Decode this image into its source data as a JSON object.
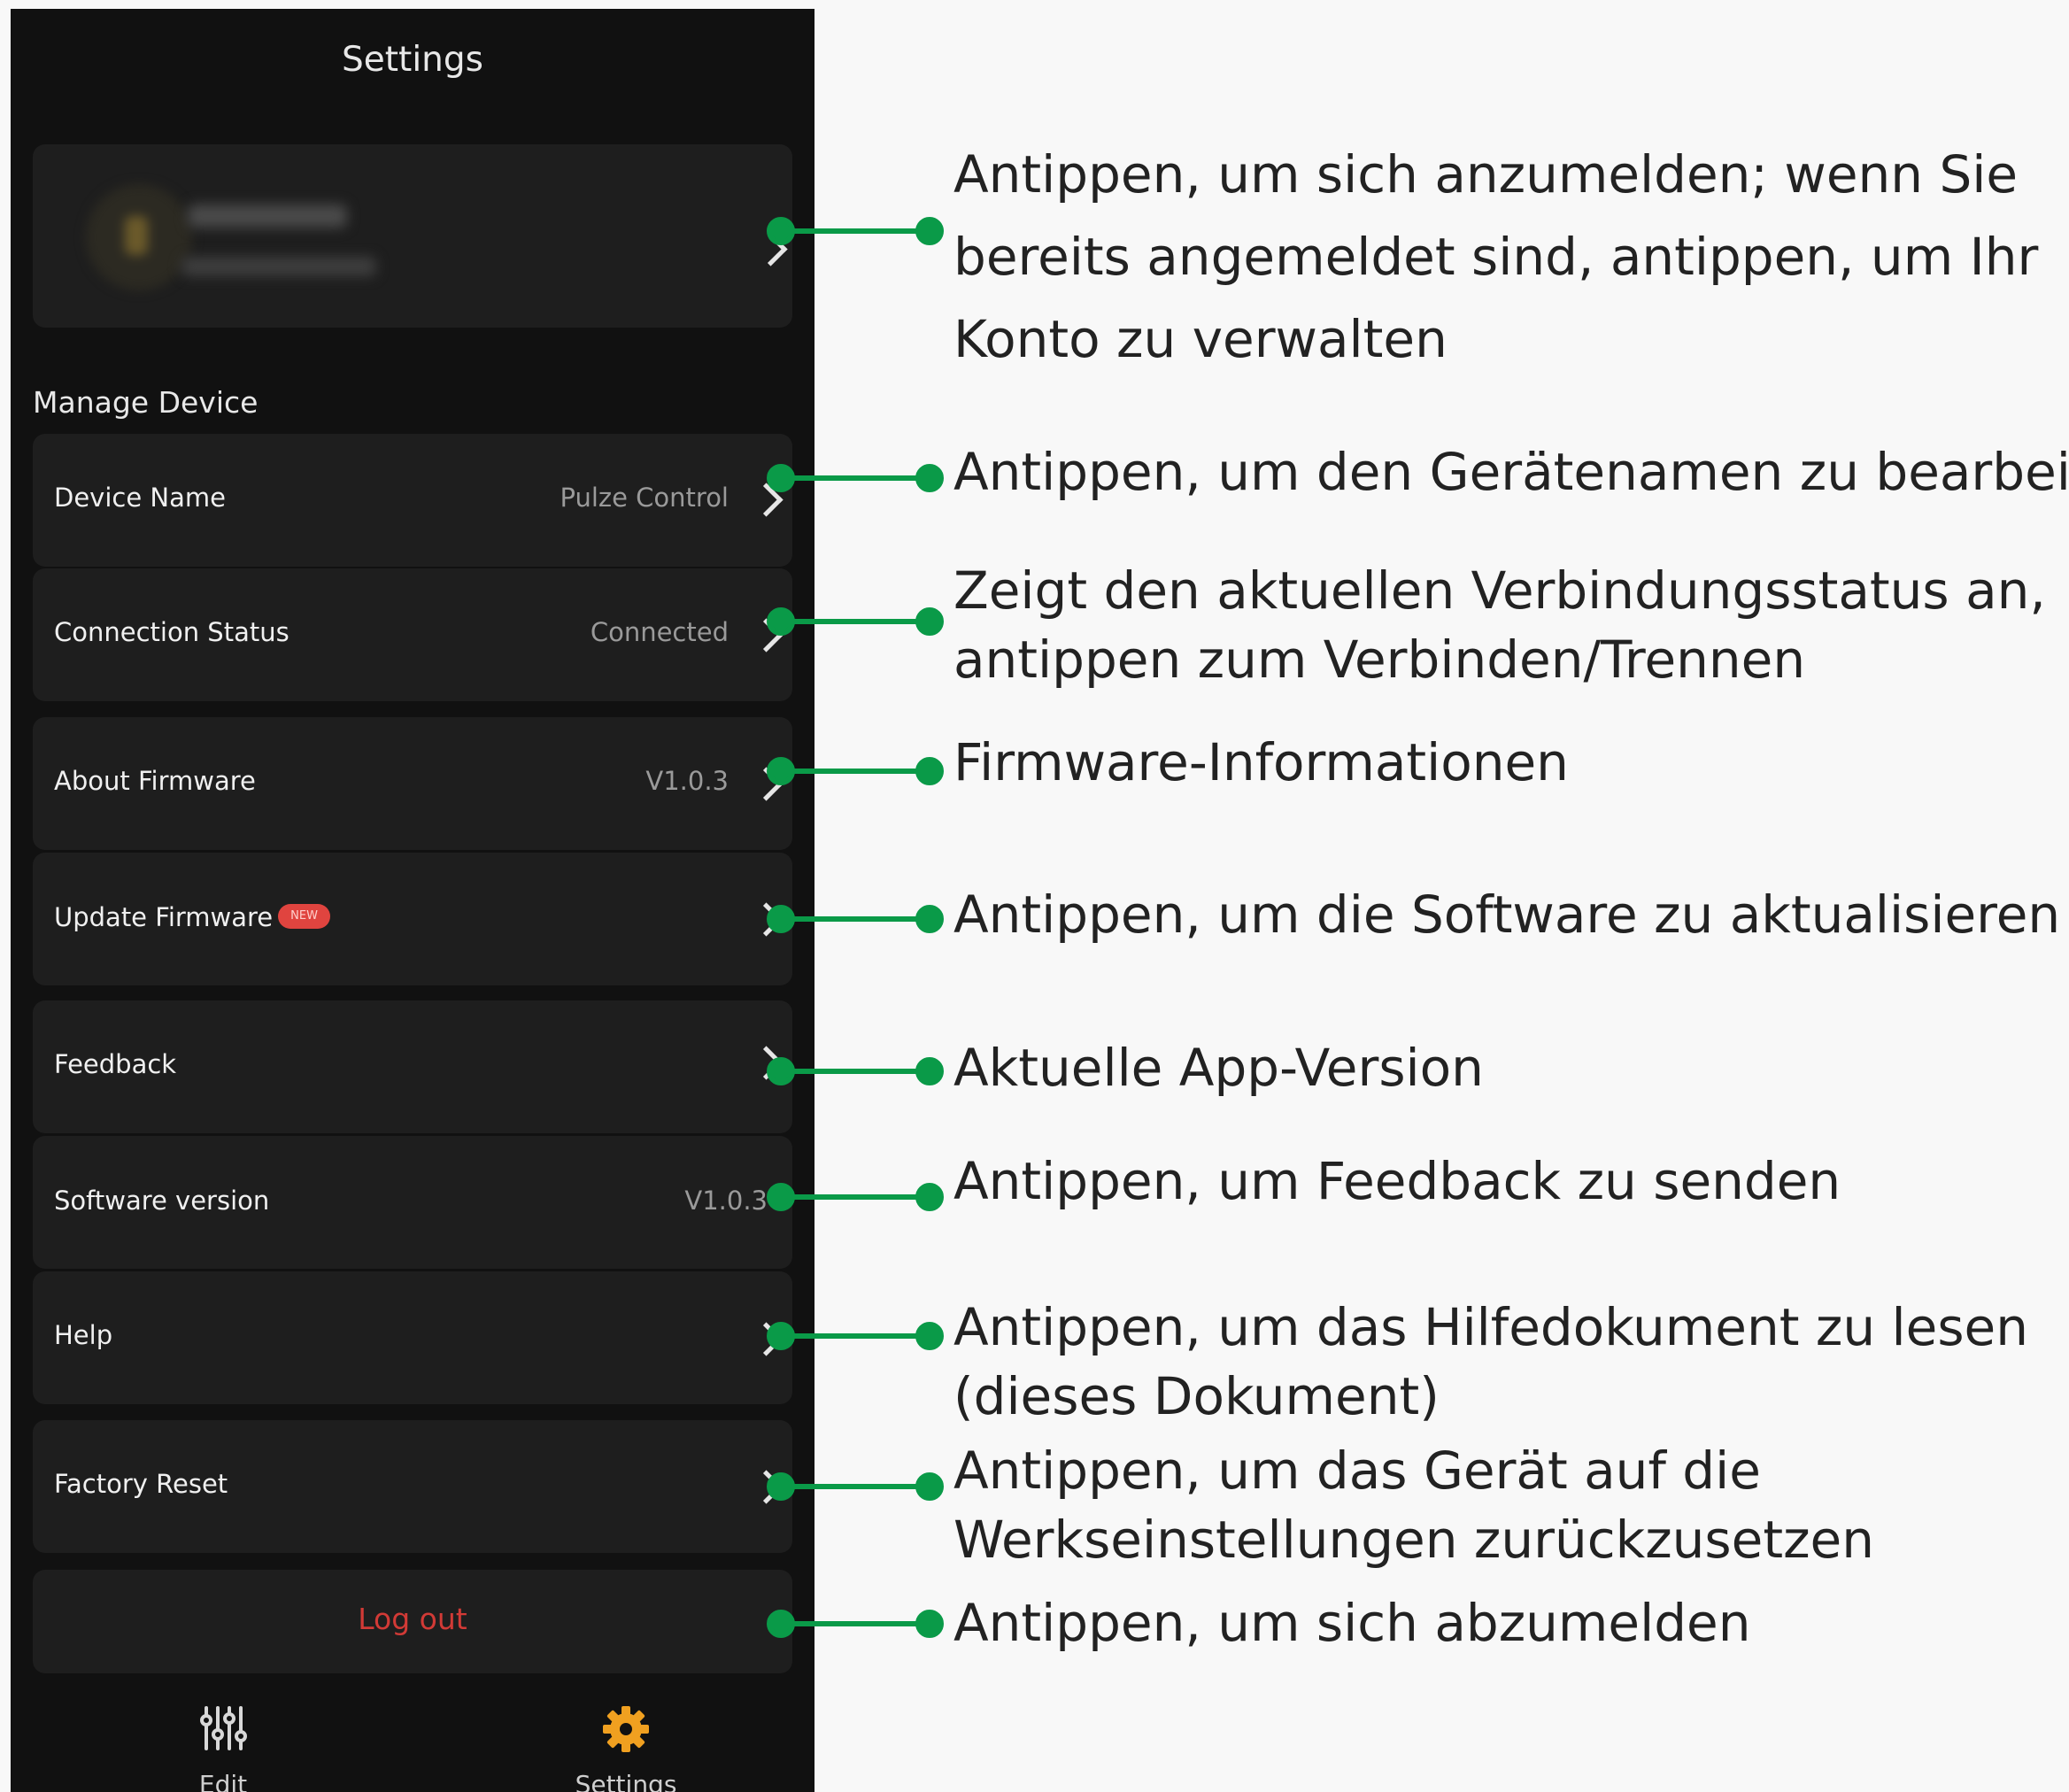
{
  "screen": {
    "title": "Settings"
  },
  "profile": {
    "name_blurred": "Shawn Wang",
    "email_blurred": "a1b2c3@mail.com"
  },
  "section_manage_device": "Manage Device",
  "rows": [
    {
      "label": "Device Name",
      "value": "Pulze Control",
      "chevron": true
    },
    {
      "label": "Connection Status",
      "value": "Connected",
      "chevron": true
    },
    {
      "label": "About Firmware",
      "value": "V1.0.3",
      "chevron": true
    },
    {
      "label": "Update Firmware",
      "badge": "NEW",
      "value": "",
      "chevron": true
    },
    {
      "label": "Feedback",
      "value": "",
      "chevron": true
    },
    {
      "label": "Software version",
      "value": "V1.0.3",
      "chevron": false
    },
    {
      "label": "Help",
      "value": "",
      "chevron": true
    },
    {
      "label": "Factory Reset",
      "value": "",
      "chevron": true
    }
  ],
  "logout_label": "Log out",
  "tabbar": {
    "edit": {
      "label": "Edit",
      "icon": "sliders-icon"
    },
    "settings": {
      "label": "Settings",
      "icon": "gear-icon"
    }
  },
  "callouts": [
    {
      "lines": [
        "Antippen, um sich anzumelden; wenn Sie",
        "bereits angemeldet sind, antippen, um Ihr",
        "Konto zu verwalten"
      ]
    },
    {
      "lines": [
        "Antippen, um den Gerätenamen zu bearbeiten"
      ]
    },
    {
      "lines": [
        "Zeigt den aktuellen Verbindungsstatus an,",
        "antippen zum Verbinden/Trennen"
      ]
    },
    {
      "lines": [
        "Firmware-Informationen"
      ]
    },
    {
      "lines": [
        "Antippen, um die Software zu aktualisieren"
      ]
    },
    {
      "lines": [
        "Aktuelle App-Version"
      ]
    },
    {
      "lines": [
        "Antippen, um Feedback zu senden"
      ]
    },
    {
      "lines": [
        "Antippen, um das Hilfedokument zu lesen",
        "(dieses Dokument)"
      ]
    },
    {
      "lines": [
        "Antippen, um das Gerät auf die",
        "Werkseinstellungen zurückzusetzen"
      ]
    },
    {
      "lines": [
        "Antippen, um sich abzumelden"
      ]
    }
  ],
  "colors": {
    "phone_bg": "#111111",
    "card_bg": "#1e1e1e",
    "connector_green": "#0a9a48",
    "logout_red": "#d23a36",
    "badge_red": "#e0443f",
    "gear_orange": "#f0a020"
  }
}
